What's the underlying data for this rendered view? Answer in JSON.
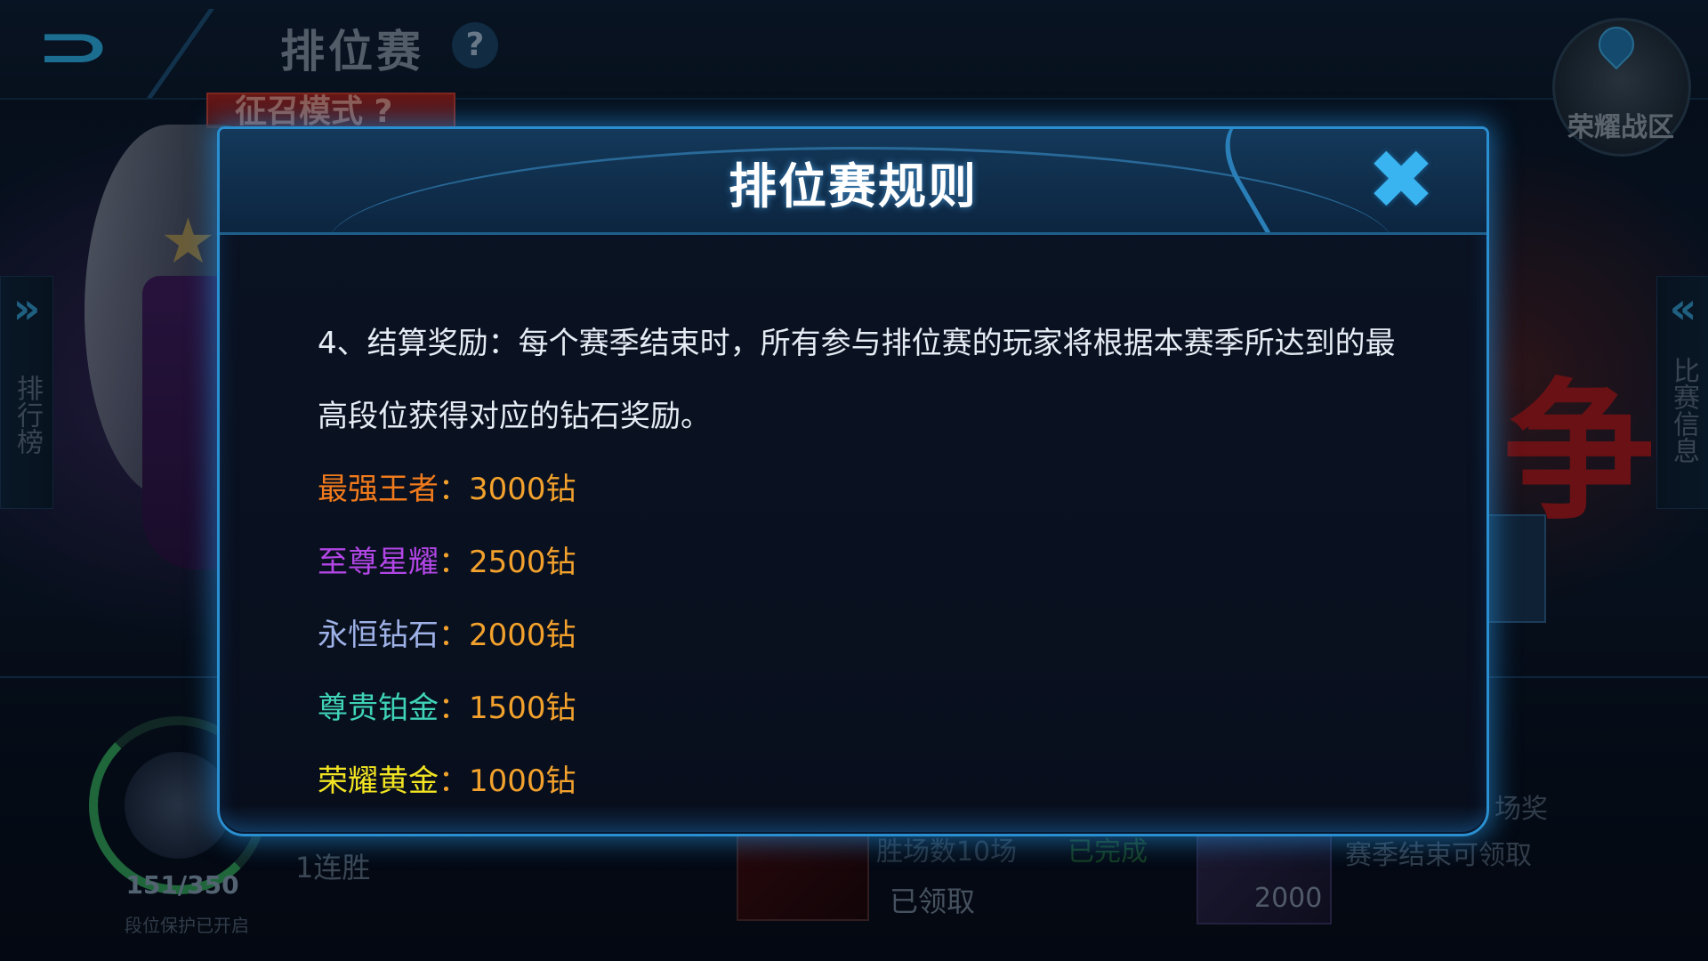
{
  "topbar": {
    "title": "排位赛",
    "help_symbol": "?",
    "summon_mode": "征召模式 ?",
    "region_label": "荣耀战区"
  },
  "side": {
    "left_chevron": "»",
    "left_label": "排行榜",
    "right_chevron": "«",
    "right_label": "比赛信息"
  },
  "bottom": {
    "rank_progress": "151/350",
    "rank_protect": "段位保护已开启",
    "streak": "1连胜",
    "task_text": "胜场数10场",
    "task_status": "已完成",
    "task_claimed": "已领取",
    "gem_value": "2000",
    "reward_title": "场奖",
    "reward_desc": "赛季结束可领取"
  },
  "modal": {
    "title": "排位赛规则",
    "close_symbol": "✖",
    "paragraph": "4、结算奖励：每个赛季结束时，所有参与排位赛的玩家将根据本赛季所达到的最高段位获得对应的钻石奖励。",
    "tiers": [
      {
        "name": "最强王者",
        "sep": "：",
        "value": "3000钻",
        "color": "#f07a1c"
      },
      {
        "name": "至尊星耀",
        "sep": "：",
        "value": "2500钻",
        "color": "#b246e6"
      },
      {
        "name": "永恒钻石",
        "sep": "：",
        "value": "2000钻",
        "color": "#9fb2e8"
      },
      {
        "name": "尊贵铂金",
        "sep": "：",
        "value": "1500钻",
        "color": "#3fd3b8"
      },
      {
        "name": "荣耀黄金",
        "sep": "：",
        "value": "1000钻",
        "color": "#f2e422"
      }
    ]
  }
}
